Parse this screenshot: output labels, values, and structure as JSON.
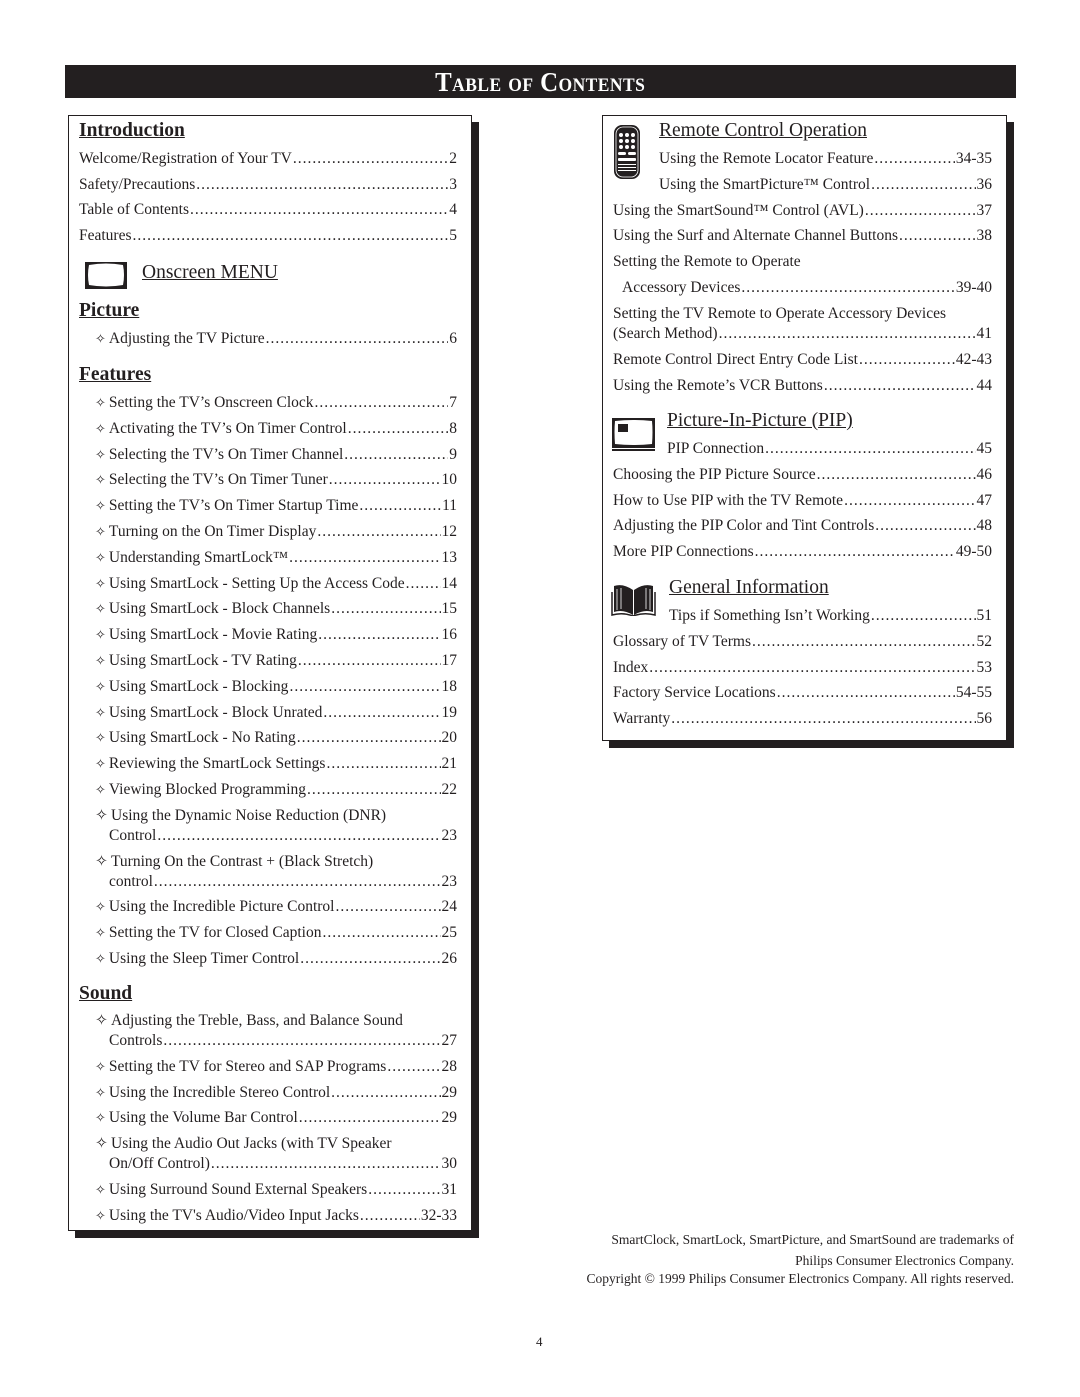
{
  "page_title": "Table of Contents",
  "left": {
    "introduction": {
      "heading": "Introduction",
      "items": [
        {
          "text": "Welcome/Registration of Your TV",
          "page": "2"
        },
        {
          "text": "Safety/Precautions",
          "page": "3"
        },
        {
          "text": "Table of Contents",
          "page": "4"
        },
        {
          "text": "Features",
          "page": "5"
        }
      ]
    },
    "onscreen_menu": {
      "heading": "Onscreen MENU",
      "icon": "tv-screen-icon"
    },
    "picture": {
      "heading": "Picture",
      "items": [
        {
          "text": "Adjusting the TV Picture",
          "page": "6"
        }
      ]
    },
    "features": {
      "heading": "Features",
      "items": [
        {
          "text": "Setting the TV’s Onscreen Clock",
          "page": "7"
        },
        {
          "text": "Activating the TV’s On Timer Control",
          "page": "8"
        },
        {
          "text": "Selecting the TV’s On Timer Channel",
          "page": "9"
        },
        {
          "text": "Selecting the TV’s On Timer Tuner",
          "page": "10"
        },
        {
          "text": "Setting the TV’s On Timer Startup Time",
          "page": "11"
        },
        {
          "text": "Turning on the On Timer Display",
          "page": "12"
        },
        {
          "text": "Understanding SmartLock™",
          "page": "13"
        },
        {
          "text": "Using SmartLock - Setting Up the Access Code",
          "page": "14"
        },
        {
          "text": "Using SmartLock - Block Channels",
          "page": "15"
        },
        {
          "text": "Using SmartLock - Movie Rating",
          "page": "16"
        },
        {
          "text": "Using SmartLock - TV Rating",
          "page": "17"
        },
        {
          "text": "Using SmartLock - Blocking",
          "page": "18"
        },
        {
          "text": "Using SmartLock - Block Unrated",
          "page": "19"
        },
        {
          "text": "Using SmartLock - No Rating",
          "page": "20"
        },
        {
          "text": "Reviewing the SmartLock Settings",
          "page": "21"
        },
        {
          "text": "Viewing Blocked Programming",
          "page": "22"
        },
        {
          "text": "Using the Dynamic Noise Reduction (DNR)",
          "cont": "Control",
          "page": "23"
        },
        {
          "text": "Turning On the Contrast + (Black Stretch)",
          "cont": "control",
          "page": "23"
        },
        {
          "text": "Using the Incredible Picture Control",
          "page": "24"
        },
        {
          "text": "Setting the TV for Closed Caption",
          "page": "25"
        },
        {
          "text": "Using the Sleep Timer Control",
          "page": "26"
        }
      ]
    },
    "sound": {
      "heading": "Sound",
      "items": [
        {
          "text": "Adjusting the Treble, Bass, and Balance Sound",
          "cont": "Controls",
          "page": "27"
        },
        {
          "text": "Setting the TV for Stereo and SAP Programs",
          "page": "28"
        },
        {
          "text": "Using the Incredible Stereo Control",
          "page": "29"
        },
        {
          "text": "Using the Volume Bar Control",
          "page": "29"
        },
        {
          "text": "Using the Audio Out Jacks (with TV Speaker",
          "cont": "On/Off Control)",
          "page": "30"
        },
        {
          "text": "Using Surround Sound External Speakers",
          "page": "31"
        },
        {
          "text": "Using the TV's Audio/Video Input Jacks",
          "page": "32-33"
        }
      ]
    },
    "bullet": "✧"
  },
  "right": {
    "remote": {
      "heading": "Remote Control Operation",
      "icon": "remote-control-icon",
      "items": [
        {
          "text": "Using the Remote Locator Feature",
          "page": "34-35"
        },
        {
          "text": "Using the SmartPicture™ Control",
          "page": "36"
        },
        {
          "text": "Using the SmartSound™ Control (AVL)",
          "page": "37"
        },
        {
          "text": "Using the Surf and Alternate Channel Buttons",
          "page": "38"
        },
        {
          "text": "Setting the Remote to Operate",
          "cont": "Accessory Devices",
          "page": "39-40"
        },
        {
          "text": "Setting the TV Remote to Operate Accessory Devices",
          "cont": "(Search Method)",
          "page": "41"
        },
        {
          "text": "Remote Control Direct Entry Code List",
          "page": "42-43"
        },
        {
          "text": "Using the Remote’s VCR Buttons",
          "page": "44"
        }
      ]
    },
    "pip": {
      "heading": "Picture-In-Picture (PIP)",
      "icon": "pip-tv-icon",
      "items": [
        {
          "text": "PIP Connection",
          "page": "45"
        },
        {
          "text": "Choosing the PIP Picture Source",
          "page": "46"
        },
        {
          "text": "How to Use PIP with the TV Remote",
          "page": "47"
        },
        {
          "text": "Adjusting the PIP Color and Tint Controls",
          "page": "48"
        },
        {
          "text": "More PIP Connections",
          "page": "49-50"
        }
      ]
    },
    "general": {
      "heading": "General Information",
      "icon": "open-book-icon",
      "items": [
        {
          "text": "Tips if Something Isn’t Working",
          "page": "51"
        },
        {
          "text": "Glossary of TV Terms",
          "page": "52"
        },
        {
          "text": "Index",
          "page": "53"
        },
        {
          "text": "Factory Service Locations",
          "page": "54-55"
        },
        {
          "text": "Warranty",
          "page": "56"
        }
      ]
    }
  },
  "footer": {
    "trademark_line1": "SmartClock, SmartLock, SmartPicture, and SmartSound are trademarks of",
    "trademark_line2": "Philips Consumer Electronics Company.",
    "copyright": "Copyright © 1999 Philips Consumer Electronics Company. All rights reserved."
  },
  "page_number": "4"
}
